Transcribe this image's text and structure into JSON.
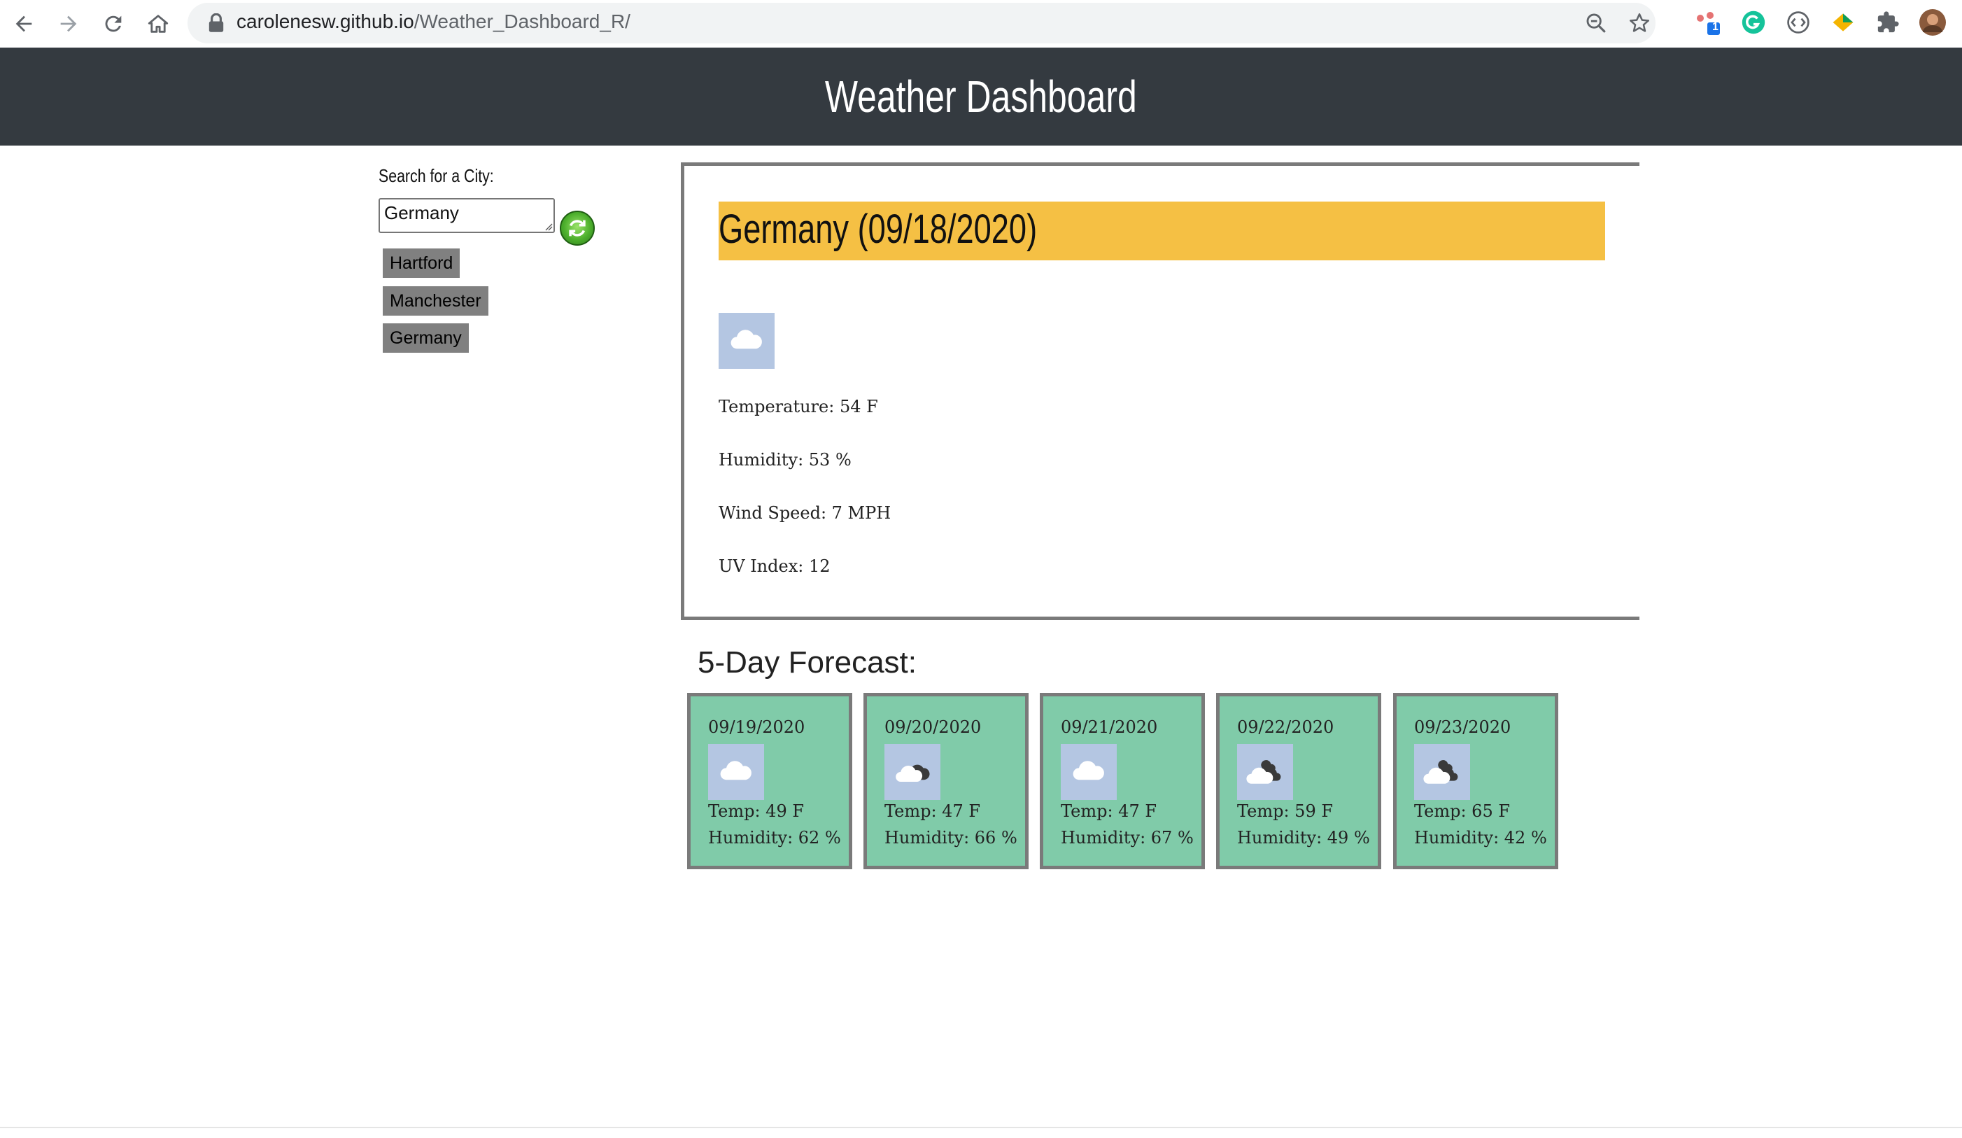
{
  "browser": {
    "url_host": "carolenesw.github.io",
    "url_path": "/Weather_Dashboard_R/",
    "extension_badge": "1"
  },
  "header": {
    "title": "Weather Dashboard"
  },
  "search": {
    "label": "Search for a City:",
    "value": "Germany"
  },
  "history": [
    "Hartford",
    "Manchester",
    "Germany"
  ],
  "current": {
    "title": "Germany (09/18/2020)",
    "icon": "cloud-icon",
    "temperature": "Temperature: 54 F",
    "humidity": "Humidity: 53 %",
    "wind": "Wind Speed: 7 MPH",
    "uv": "UV Index: 12"
  },
  "forecast": {
    "heading": "5-Day Forecast:",
    "days": [
      {
        "date": "09/19/2020",
        "icon": "cloud-icon",
        "temp": "Temp: 49 F",
        "humidity": "Humidity: 62 %"
      },
      {
        "date": "09/20/2020",
        "icon": "dark-cloud-icon",
        "temp": "Temp: 47 F",
        "humidity": "Humidity: 66 %"
      },
      {
        "date": "09/21/2020",
        "icon": "cloud-icon",
        "temp": "Temp: 47 F",
        "humidity": "Humidity: 67 %"
      },
      {
        "date": "09/22/2020",
        "icon": "broken-clouds-icon",
        "temp": "Temp: 59 F",
        "humidity": "Humidity: 49 %"
      },
      {
        "date": "09/23/2020",
        "icon": "broken-clouds-icon",
        "temp": "Temp: 65 F",
        "humidity": "Humidity: 42 %"
      }
    ]
  },
  "colors": {
    "header_bg": "#343a40",
    "banner": "#f5c044",
    "forecast_card": "#80cba9",
    "history_item": "#808080",
    "icon_bg": "#b4c6e2"
  }
}
